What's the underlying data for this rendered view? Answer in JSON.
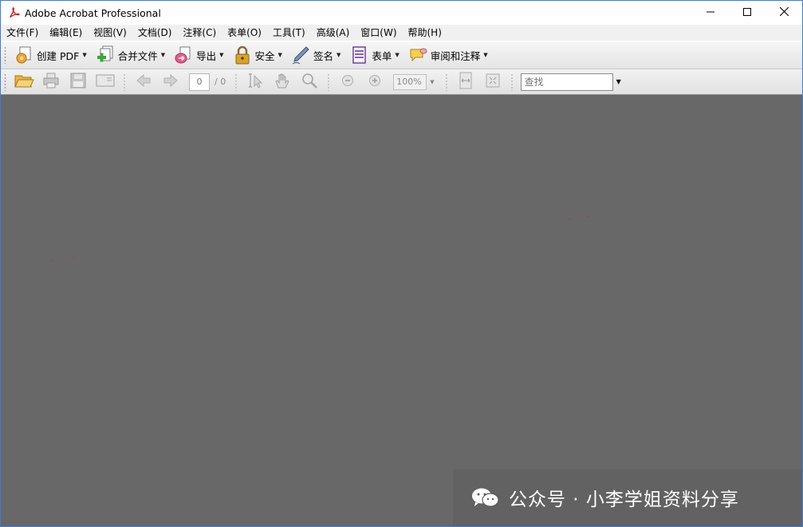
{
  "window": {
    "title": "Adobe Acrobat Professional"
  },
  "menu": [
    "文件(F)",
    "编辑(E)",
    "视图(V)",
    "文档(D)",
    "注释(C)",
    "表单(O)",
    "工具(T)",
    "高级(A)",
    "窗口(W)",
    "帮助(H)"
  ],
  "task_toolbar": {
    "create_pdf": "创建 PDF",
    "combine_files": "合并文件",
    "export": "导出",
    "secure": "安全",
    "sign": "签名",
    "forms": "表单",
    "review_comment": "审阅和注释"
  },
  "standard_toolbar": {
    "page_current": "0",
    "page_total": "/ 0",
    "zoom": "100%",
    "find_placeholder": "查找"
  },
  "watermark": {
    "text": "公众号 · 小李学姐资料分享"
  },
  "icons": [
    "pdf-logo-icon",
    "minimize-icon",
    "maximize-icon",
    "close-icon",
    "create-pdf-icon",
    "combine-files-icon",
    "export-icon",
    "lock-icon",
    "pen-icon",
    "form-icon",
    "comment-icon",
    "open-folder-icon",
    "print-icon",
    "save-icon",
    "email-icon",
    "previous-page-icon",
    "next-page-icon",
    "select-tool-icon",
    "hand-tool-icon",
    "zoom-tool-icon",
    "zoom-out-icon",
    "zoom-in-icon",
    "fit-page-icon",
    "full-screen-icon",
    "wechat-icon"
  ]
}
